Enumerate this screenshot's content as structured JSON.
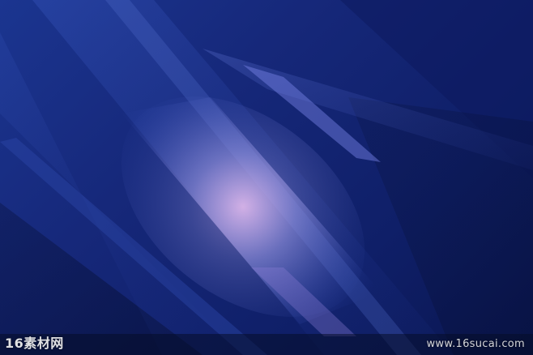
{
  "watermark": {
    "left_text": "16素材网",
    "right_text": "www.16sucai.com"
  },
  "colors": {
    "base": "#16287a",
    "dark": "#0a1650",
    "highlight": "#c7a6e0",
    "streak": "#4d6fd0"
  }
}
